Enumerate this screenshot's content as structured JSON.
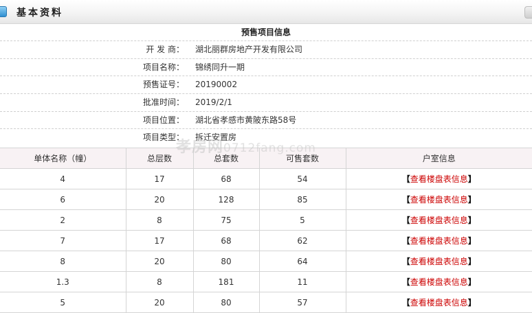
{
  "header": {
    "title": "基本资料"
  },
  "info": {
    "title": "预售项目信息",
    "rows": [
      {
        "label": "开 发 商：",
        "value": "湖北丽群房地产开发有限公司"
      },
      {
        "label": "项目名称：",
        "value": "锦绣同升一期"
      },
      {
        "label": "预售证号：",
        "value": "20190002"
      },
      {
        "label": "批准时间：",
        "value": "2019/2/1"
      },
      {
        "label": "项目位置：",
        "value": "湖北省孝感市黄陂东路58号"
      },
      {
        "label": "项目类型：",
        "value": "拆迁安置房"
      }
    ]
  },
  "table": {
    "headers": [
      "单体名称（幢）",
      "总层数",
      "总套数",
      "可售套数",
      "户室信息"
    ],
    "link_text": "查看楼盘表信息",
    "rows": [
      [
        "4",
        "17",
        "68",
        "54"
      ],
      [
        "6",
        "20",
        "128",
        "85"
      ],
      [
        "2",
        "8",
        "75",
        "5"
      ],
      [
        "7",
        "17",
        "68",
        "62"
      ],
      [
        "8",
        "20",
        "80",
        "64"
      ],
      [
        "1.3",
        "8",
        "181",
        "11"
      ],
      [
        "5",
        "20",
        "80",
        "57"
      ]
    ]
  },
  "watermark": {
    "brand": "孝房网",
    "domain": "0712fang.com"
  }
}
